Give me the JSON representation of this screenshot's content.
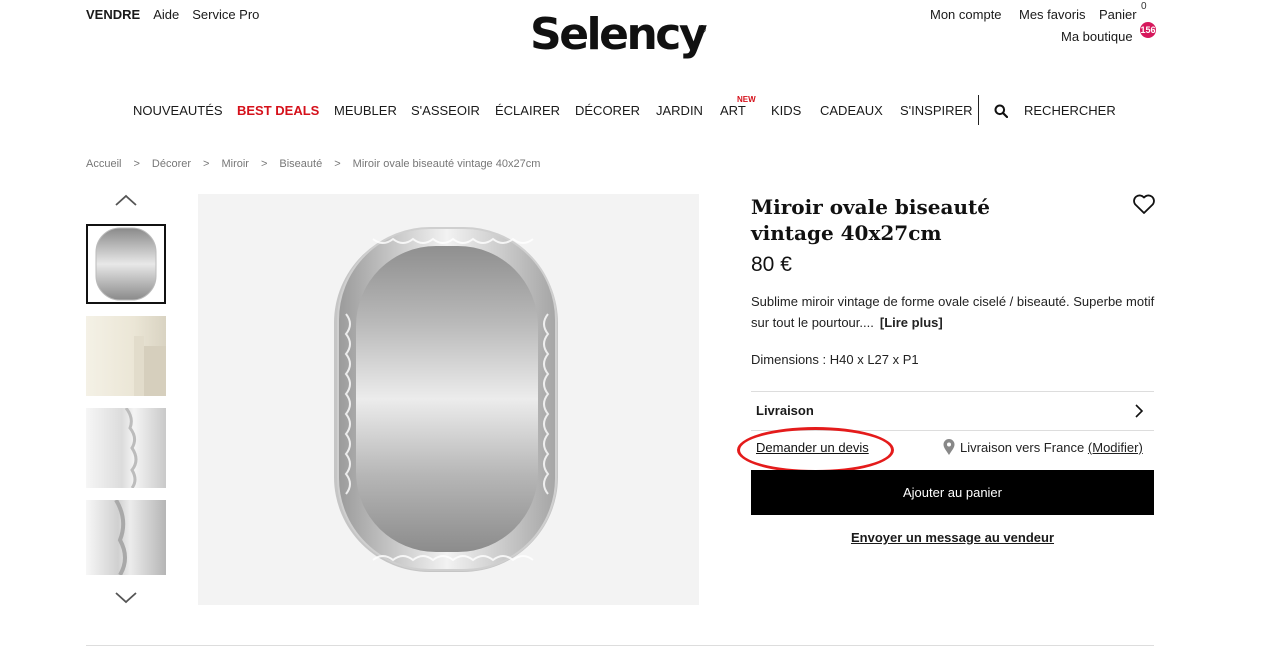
{
  "header": {
    "top_left": [
      "VENDRE",
      "Aide",
      "Service Pro"
    ],
    "logo": "Selency",
    "logo_mark": "®",
    "account": "Mon compte",
    "favorites": "Mes favoris",
    "cart": "Panier",
    "cart_count": "0",
    "shop": "Ma boutique",
    "shop_badge": "156"
  },
  "nav": {
    "items": [
      "NOUVEAUTÉS",
      "BEST DEALS",
      "MEUBLER",
      "S'ASSEOIR",
      "ÉCLAIRER",
      "DÉCORER",
      "JARDIN",
      "ART",
      "KIDS",
      "CADEAUX",
      "S'INSPIRER"
    ],
    "new_badge": "NEW",
    "search": "RECHERCHER",
    "accent_color": "#d5101a"
  },
  "breadcrumb": [
    "Accueil",
    ">",
    "Décorer",
    ">",
    "Miroir",
    ">",
    "Biseauté",
    ">",
    "Miroir ovale biseauté vintage 40x27cm"
  ],
  "product": {
    "title_line1": "Miroir ovale biseauté",
    "title_line2": "vintage 40x27cm",
    "price": "80 €",
    "description": "Sublime miroir vintage de forme ovale ciselé / biseauté. Superbe motif sur tout le pourtour....",
    "read_more": "[Lire plus]",
    "dimensions": "Dimensions : H40 x L27 x P1",
    "delivery_label": "Livraison",
    "quote_link": "Demander un devis",
    "shipping_text": "Livraison vers France",
    "shipping_modify": "(Modifier)",
    "add_to_cart": "Ajouter au panier",
    "message_seller": "Envoyer un message au vendeur"
  },
  "icons": [
    "search-icon",
    "heart-icon",
    "chevron-up-icon",
    "chevron-down-icon",
    "chevron-right-icon",
    "location-pin-icon"
  ],
  "annotation_color": "#e41b1b"
}
